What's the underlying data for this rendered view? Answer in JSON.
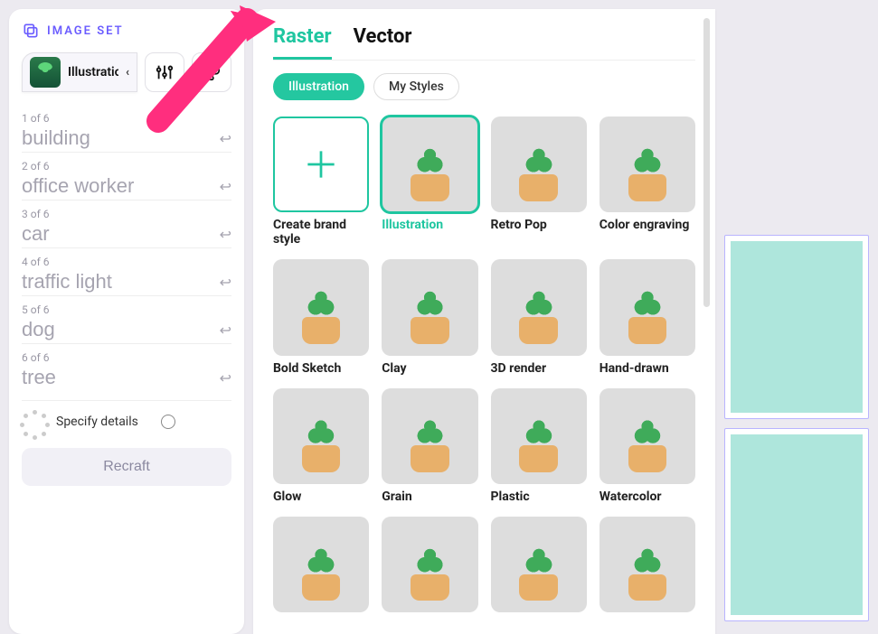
{
  "sidebar": {
    "title": "IMAGE SET",
    "selector_label": "Illustratio",
    "prompts": [
      {
        "idx": "1 of 6",
        "text": "building"
      },
      {
        "idx": "2 of 6",
        "text": "office worker"
      },
      {
        "idx": "3 of 6",
        "text": "car"
      },
      {
        "idx": "4 of 6",
        "text": "traffic light"
      },
      {
        "idx": "5 of 6",
        "text": "dog"
      },
      {
        "idx": "6 of 6",
        "text": "tree"
      }
    ],
    "specify_label": "Specify details",
    "recraft_label": "Recraft"
  },
  "main": {
    "tabs": [
      {
        "label": "Raster",
        "active": true
      },
      {
        "label": "Vector",
        "active": false
      }
    ],
    "filters": [
      {
        "label": "Illustration",
        "active": true
      },
      {
        "label": "My Styles",
        "active": false
      }
    ],
    "styles": [
      {
        "label": "Create brand style",
        "type": "create"
      },
      {
        "label": "Illustration",
        "selected": true,
        "bg": "bg-illus"
      },
      {
        "label": "Retro Pop",
        "bg": "bg-retro"
      },
      {
        "label": "Color engraving",
        "bg": "bg-engr"
      },
      {
        "label": "Bold Sketch",
        "bg": "bg-bold"
      },
      {
        "label": "Clay",
        "bg": "bg-clay"
      },
      {
        "label": "3D render",
        "bg": "bg-3d"
      },
      {
        "label": "Hand-drawn",
        "bg": "bg-hand"
      },
      {
        "label": "Glow",
        "bg": "bg-glow"
      },
      {
        "label": "Grain",
        "bg": "bg-grain"
      },
      {
        "label": "Plastic",
        "bg": "bg-plastic"
      },
      {
        "label": "Watercolor",
        "bg": "bg-water"
      },
      {
        "label": "",
        "bg": "bg-r4a"
      },
      {
        "label": "",
        "bg": "bg-r4b"
      },
      {
        "label": "",
        "bg": "bg-r4c"
      },
      {
        "label": "",
        "bg": "bg-r4d"
      }
    ]
  },
  "colors": {
    "accent": "#1fc6a0",
    "arrow": "#ff2e7e",
    "brand": "#6a5cff"
  }
}
